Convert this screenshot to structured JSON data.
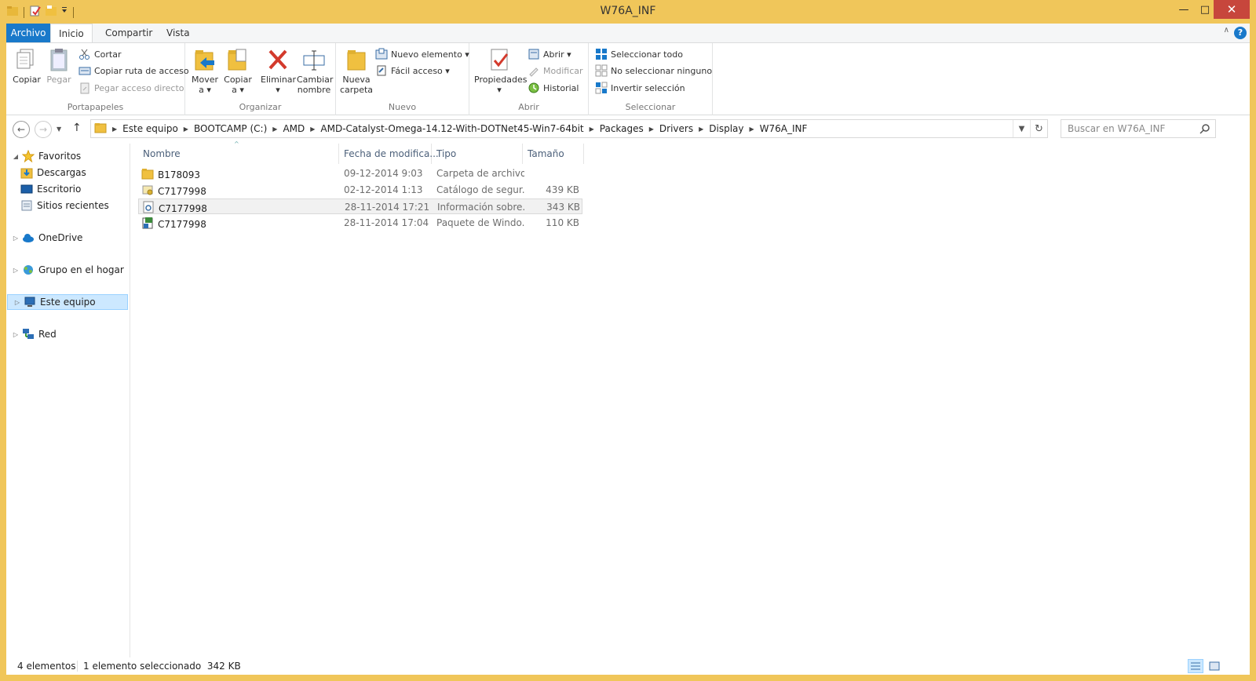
{
  "window": {
    "title": "W76A_INF",
    "minimize_glyph": "—",
    "maximize_glyph": "□",
    "close_glyph": "✕"
  },
  "ribbon_tabs": {
    "file": "Archivo",
    "home": "Inicio",
    "share": "Compartir",
    "view": "Vista",
    "help": "?"
  },
  "ribbon": {
    "clipboard": {
      "label": "Portapapeles",
      "copy": "Copiar",
      "paste": "Pegar",
      "cut": "Cortar",
      "copy_path": "Copiar ruta de acceso",
      "paste_shortcut": "Pegar acceso directo"
    },
    "organize": {
      "label": "Organizar",
      "move_to_1": "Mover",
      "move_to_2": "a ▾",
      "copy_to_1": "Copiar",
      "copy_to_2": "a ▾",
      "delete_1": "Eliminar",
      "delete_2": "▾",
      "rename_1": "Cambiar",
      "rename_2": "nombre"
    },
    "new": {
      "label": "Nuevo",
      "new_folder_1": "Nueva",
      "new_folder_2": "carpeta",
      "new_item": "Nuevo elemento ▾",
      "easy_access": "Fácil acceso ▾"
    },
    "open": {
      "label": "Abrir",
      "properties_1": "Propiedades",
      "properties_2": "▾",
      "open": "Abrir ▾",
      "edit": "Modificar",
      "history": "Historial"
    },
    "select": {
      "label": "Seleccionar",
      "select_all": "Seleccionar todo",
      "select_none": "No seleccionar ninguno",
      "invert": "Invertir selección"
    }
  },
  "address": {
    "crumbs": [
      "Este equipo",
      "BOOTCAMP (C:)",
      "AMD",
      "AMD-Catalyst-Omega-14.12-With-DOTNet45-Win7-64bit",
      "Packages",
      "Drivers",
      "Display",
      "W76A_INF"
    ],
    "search_placeholder": "Buscar en W76A_INF"
  },
  "nav_pane": {
    "favorites": "Favoritos",
    "downloads": "Descargas",
    "desktop": "Escritorio",
    "recent": "Sitios recientes",
    "onedrive": "OneDrive",
    "homegroup": "Grupo en el hogar",
    "this_pc": "Este equipo",
    "network": "Red"
  },
  "columns": {
    "name": "Nombre",
    "date": "Fecha de modifica...",
    "type": "Tipo",
    "size": "Tamaño"
  },
  "files": [
    {
      "name": "B178093",
      "date": "09-12-2014 9:03",
      "type": "Carpeta de archivos",
      "size": "",
      "icon": "folder-icon"
    },
    {
      "name": "C7177998",
      "date": "02-12-2014 1:13",
      "type": "Catálogo de segur...",
      "size": "439 KB",
      "icon": "security-catalog-icon"
    },
    {
      "name": "C7177998",
      "date": "28-11-2014 17:21",
      "type": "Información sobre...",
      "size": "343 KB",
      "icon": "setup-info-icon"
    },
    {
      "name": "C7177998",
      "date": "28-11-2014 17:04",
      "type": "Paquete de Windo...",
      "size": "110 KB",
      "icon": "installer-package-icon"
    }
  ],
  "status": {
    "count": "4 elementos",
    "selection": "1 elemento seleccionado  342 KB"
  },
  "colors": {
    "frame": "#f0c65a",
    "file_tab": "#1979ca",
    "selection": "#cce8ff",
    "close_button": "#c7463c"
  }
}
